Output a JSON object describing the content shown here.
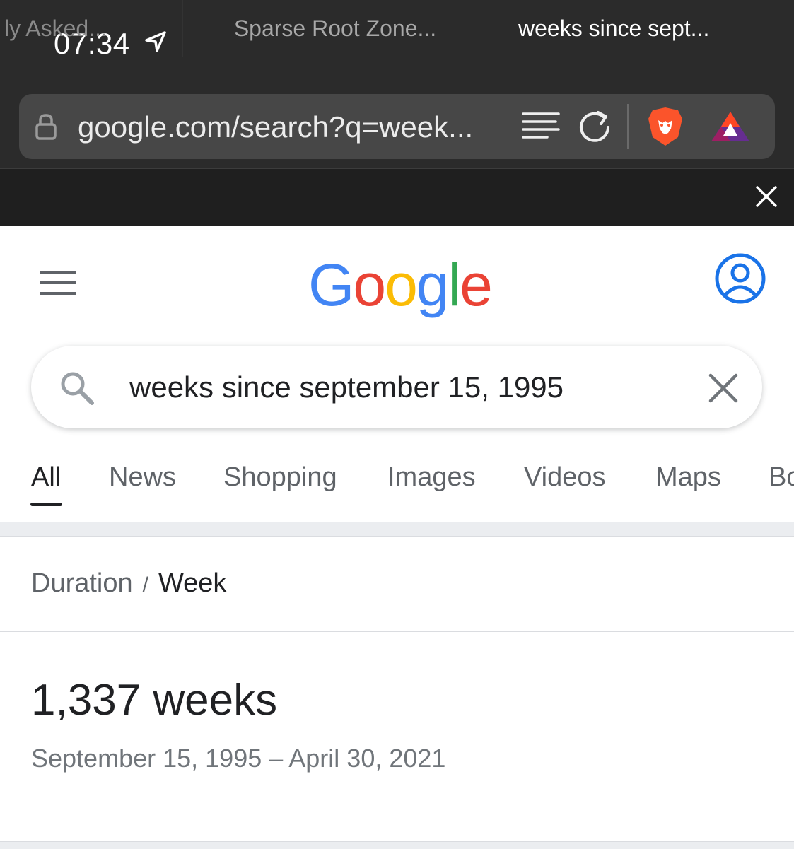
{
  "status_bar": {
    "time": "07:34"
  },
  "browser": {
    "url": "google.com/search?q=week...",
    "tabs": [
      {
        "label": "ly Asked..."
      },
      {
        "label": "Sparse Root Zone..."
      },
      {
        "label": "weeks since sept..."
      }
    ]
  },
  "google": {
    "logo_letters": [
      "G",
      "o",
      "o",
      "g",
      "l",
      "e"
    ],
    "logo_colors": [
      "#4285F4",
      "#EA4335",
      "#FBBC05",
      "#4285F4",
      "#34A853",
      "#EA4335"
    ],
    "query": "weeks since september 15, 1995",
    "filters": [
      "All",
      "News",
      "Shopping",
      "Images",
      "Videos",
      "Maps",
      "Bo"
    ],
    "active_filter": "All",
    "accent": "#1a73e8"
  },
  "result": {
    "breadcrumb_parent": "Duration",
    "breadcrumb_separator": "/",
    "breadcrumb_current": "Week",
    "value": "1,337 weeks",
    "range": "September 15, 1995 – April 30, 2021"
  }
}
